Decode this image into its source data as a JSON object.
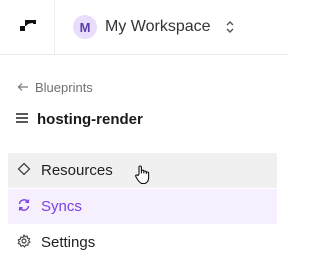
{
  "workspace": {
    "avatar_letter": "M",
    "name": "My Workspace"
  },
  "back_link": {
    "label": "Blueprints"
  },
  "blueprint": {
    "title": "hosting-render"
  },
  "nav": {
    "items": [
      {
        "label": "Resources",
        "icon": "diamond-icon",
        "state": "hover"
      },
      {
        "label": "Syncs",
        "icon": "sync-icon",
        "state": "active"
      },
      {
        "label": "Settings",
        "icon": "gear-icon",
        "state": "default"
      }
    ]
  },
  "colors": {
    "accent": "#7b3fe4",
    "active_bg": "#f6effd",
    "hover_bg": "#f0f0f0"
  }
}
